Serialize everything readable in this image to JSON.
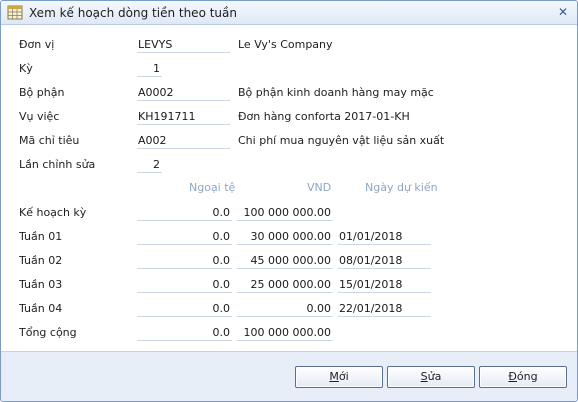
{
  "window": {
    "title": "Xem kế hoạch dòng tiền theo tuần",
    "close_glyph": "✕"
  },
  "info_rows": [
    {
      "label": "Đơn vị",
      "code": "LEVYS",
      "desc": "Le Vy's Company"
    },
    {
      "label": "Kỳ",
      "code": "1",
      "desc": ""
    },
    {
      "label": "Bộ phận",
      "code": "A0002",
      "desc": "Bộ phận kinh doanh hàng may mặc"
    },
    {
      "label": "Vụ việc",
      "code": "KH191711",
      "desc": "Đơn hàng conforta 2017-01-KH"
    },
    {
      "label": "Mã chỉ tiêu",
      "code": "A002",
      "desc": "Chi phí mua nguyên vật liệu sản xuất"
    },
    {
      "label": "Lần chỉnh sửa",
      "code": "2",
      "desc": ""
    }
  ],
  "columns": {
    "foreign": "Ngoại tệ",
    "vnd": "VND",
    "date": "Ngày dự kiến"
  },
  "plan_rows": [
    {
      "label": "Kế hoạch kỳ",
      "foreign": "0.0",
      "vnd": "100 000 000.00",
      "date": ""
    },
    {
      "label": "Tuần 01",
      "foreign": "0.0",
      "vnd": "30 000 000.00",
      "date": "01/01/2018"
    },
    {
      "label": "Tuần 02",
      "foreign": "0.0",
      "vnd": "45 000 000.00",
      "date": "08/01/2018"
    },
    {
      "label": "Tuần 03",
      "foreign": "0.0",
      "vnd": "25 000 000.00",
      "date": "15/01/2018"
    },
    {
      "label": "Tuần 04",
      "foreign": "0.0",
      "vnd": "0.00",
      "date": "22/01/2018"
    },
    {
      "label": "Tổng cộng",
      "foreign": "0.0",
      "vnd": "100 000 000.00",
      "date": ""
    }
  ],
  "buttons": {
    "new": {
      "hotkey": "M",
      "rest": "ới"
    },
    "edit": {
      "hotkey": "S",
      "rest": "ửa"
    },
    "close": {
      "hotkey": "Đ",
      "rest": "óng"
    }
  },
  "colors": {
    "accent": "#7a9cc6",
    "column_header": "#8fa5c3",
    "footer": "#e7eef8"
  }
}
